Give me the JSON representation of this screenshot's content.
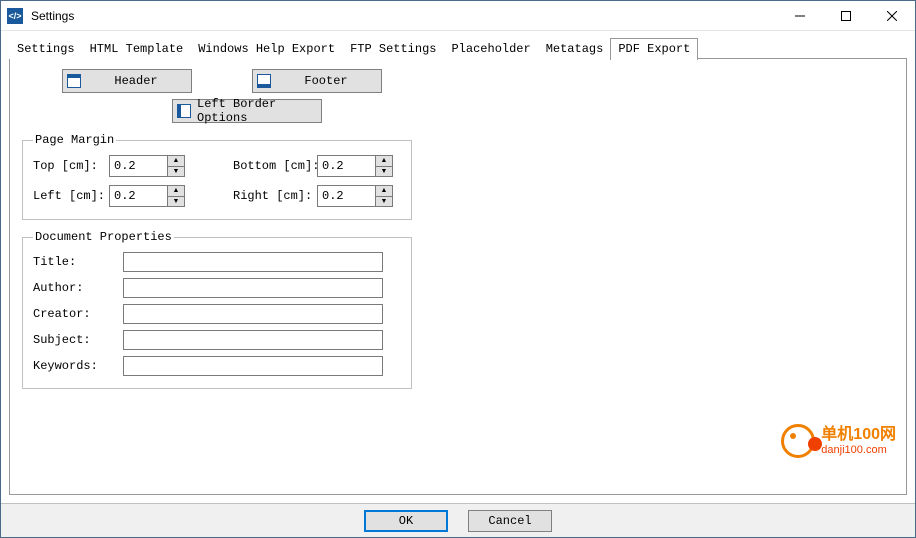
{
  "window": {
    "title": "Settings"
  },
  "tabs": [
    {
      "label": "Settings",
      "active": false
    },
    {
      "label": "HTML Template",
      "active": false
    },
    {
      "label": "Windows Help Export",
      "active": false
    },
    {
      "label": "FTP Settings",
      "active": false
    },
    {
      "label": "Placeholder",
      "active": false
    },
    {
      "label": "Metatags",
      "active": false
    },
    {
      "label": "PDF Export",
      "active": true
    }
  ],
  "buttons": {
    "header": "Header",
    "footer": "Footer",
    "left_border": "Left Border Options"
  },
  "page_margin": {
    "legend": "Page Margin",
    "top_label": "Top [cm]:",
    "top_value": "0.2",
    "bottom_label": "Bottom [cm]:",
    "bottom_value": "0.2",
    "left_label": "Left [cm]:",
    "left_value": "0.2",
    "right_label": "Right [cm]:",
    "right_value": "0.2"
  },
  "doc_props": {
    "legend": "Document Properties",
    "title_label": "Title:",
    "title_value": "",
    "author_label": "Author:",
    "author_value": "",
    "creator_label": "Creator:",
    "creator_value": "",
    "subject_label": "Subject:",
    "subject_value": "",
    "keywords_label": "Keywords:",
    "keywords_value": ""
  },
  "dialog": {
    "ok": "OK",
    "cancel": "Cancel"
  },
  "watermark": {
    "line1": "单机100网",
    "line2": "danji100.com"
  }
}
